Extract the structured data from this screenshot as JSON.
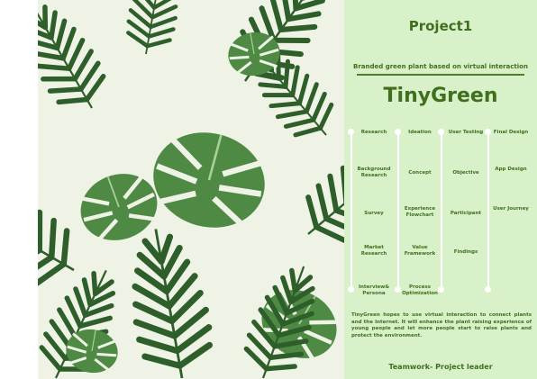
{
  "panel": {
    "project_title": "Project1",
    "subtitle": "Branded green plant based on virtual interaction",
    "brand": "TinyGreen",
    "columns": [
      {
        "header": "Research",
        "items": [
          "Background Research",
          "Survey",
          "Market Research",
          "Interview& Persona"
        ]
      },
      {
        "header": "Ideation",
        "items": [
          "Concept",
          "Experience Flowchart",
          "Value Framework",
          "Process Optimization"
        ]
      },
      {
        "header": "User Testing",
        "items": [
          "Objective",
          "Participant",
          "Findings"
        ]
      },
      {
        "header": "Final Design",
        "items": [
          "App Design",
          "User Journey"
        ]
      }
    ],
    "description": "TinyGreen hopes to use virtual interaction to connect plants and the Internet. It will enhance the plant raising experience of young people and let more people start to raise plants and protect the environment.",
    "footer": "Teamwork- Project leader"
  },
  "colors": {
    "accent": "#3f6f1f",
    "panel_bg": "#d9f1c9",
    "leaf_dark": "#2e5e2a",
    "leaf_mid": "#4f8a45",
    "leaf_light": "#a9cf9a"
  }
}
